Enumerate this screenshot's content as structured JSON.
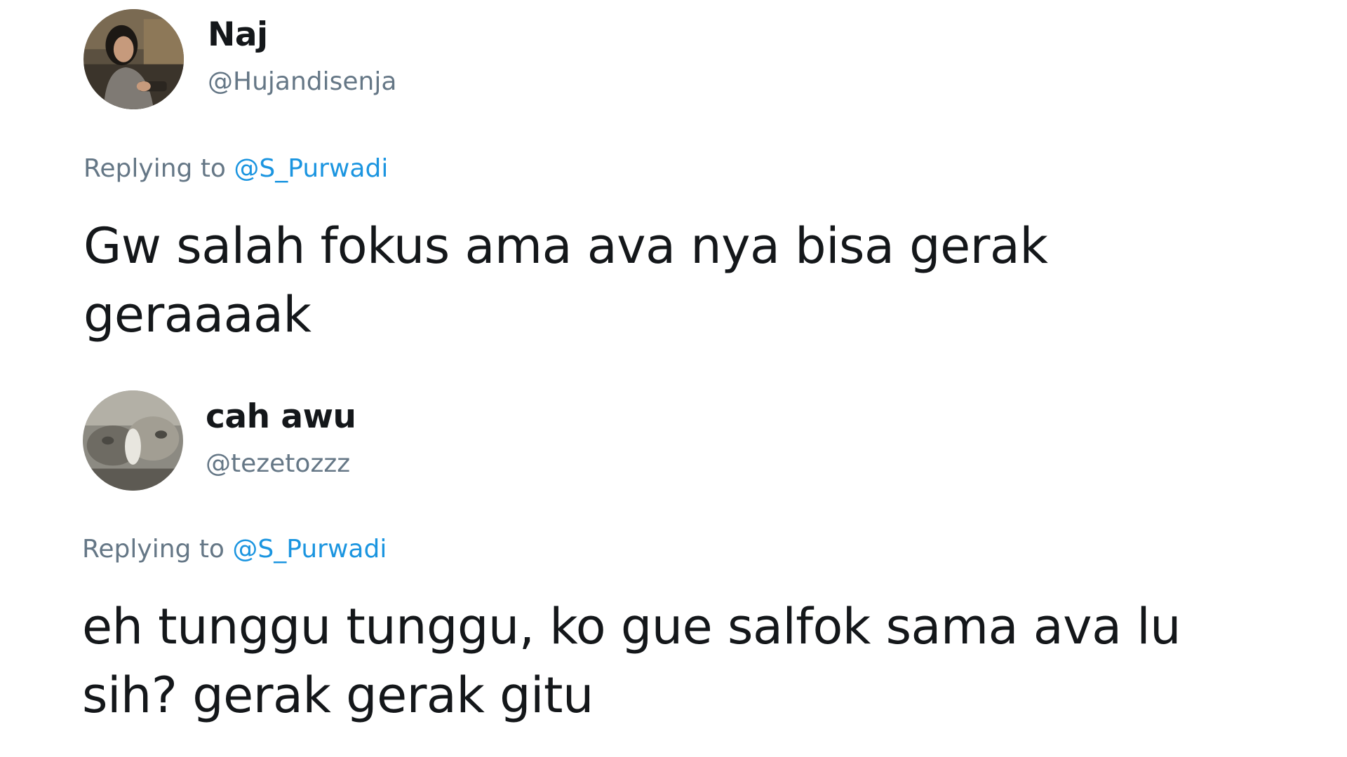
{
  "tweets": [
    {
      "display_name": "Naj",
      "handle": "@Hujandisenja",
      "reply_prefix": "Replying to",
      "reply_to": "@S_Purwadi",
      "text": "Gw salah fokus ama ava nya bisa gerak geraaaak",
      "avatar_icon": "person-photo-avatar"
    },
    {
      "display_name": "cah awu",
      "handle": "@tezetozzz",
      "reply_prefix": "Replying to",
      "reply_to": "@S_Purwadi",
      "text": "eh tunggu tunggu, ko gue salfok sama ava lu sih? gerak gerak gitu",
      "avatar_icon": "cats-photo-avatar"
    }
  ],
  "colors": {
    "text_primary": "#14171a",
    "text_secondary": "#657786",
    "link": "#1b95e0",
    "background": "#ffffff"
  }
}
